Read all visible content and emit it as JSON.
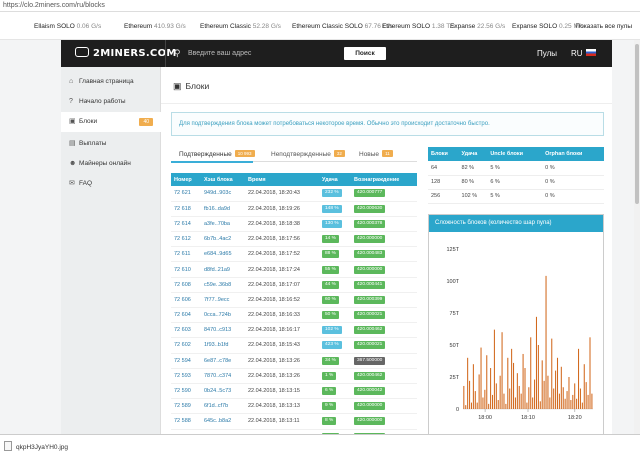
{
  "browser": {
    "url": "https://clo.2miners.com/ru/blocks"
  },
  "ticker": {
    "items": [
      {
        "name": "Ellaism SOLO",
        "value": "0.06 G/s"
      },
      {
        "name": "Ethereum",
        "value": "410.93 G/s"
      },
      {
        "name": "Ethereum Classic",
        "value": "52.28 G/s"
      },
      {
        "name": "Ethereum Classic SOLO",
        "value": "67.76 G/s"
      },
      {
        "name": "Ethereum SOLO",
        "value": "1.38 T/s"
      },
      {
        "name": "Expanse",
        "value": "22.56 G/s"
      },
      {
        "name": "Expanse SOLO",
        "value": "0.25 M/s"
      }
    ],
    "show_all": "Показать все пулы"
  },
  "navbar": {
    "logo": "2MINERS.COM",
    "search_placeholder": "Введите ваш адрес",
    "search_button": "Поиск",
    "pools": "Пулы",
    "lang": "RU"
  },
  "sidebar": {
    "items": [
      {
        "label": "Главная страница",
        "icon": "home-icon",
        "glyph": "⌂"
      },
      {
        "label": "Начало работы",
        "icon": "question-icon",
        "glyph": "?"
      },
      {
        "label": "Блоки",
        "icon": "cubes-icon",
        "glyph": "▣",
        "badge": "40"
      },
      {
        "label": "Выплаты",
        "icon": "money-icon",
        "glyph": "▤"
      },
      {
        "label": "Майнеры онлайн",
        "icon": "users-icon",
        "glyph": "☻"
      },
      {
        "label": "FAQ",
        "icon": "comments-icon",
        "glyph": "✉"
      }
    ]
  },
  "main": {
    "title": "Блоки",
    "notice": "Для подтверждения блока может потребоваться некоторое время. Обычно это происходит достаточно быстро.",
    "tabs": [
      {
        "label": "Подтвержденные",
        "count": "10 993"
      },
      {
        "label": "Неподтвержденные",
        "count": "32"
      },
      {
        "label": "Новые",
        "count": "11"
      }
    ]
  },
  "blocks": {
    "headers": [
      "Номер",
      "Хэш блока",
      "Время",
      "Удача",
      "Вознаграждение"
    ],
    "rows": [
      [
        "72 621",
        "949d..903c",
        "22.04.2018, 18:20:43",
        "232 %",
        "blue",
        "420.000777",
        "green"
      ],
      [
        "72 618",
        "fb16..da9d",
        "22.04.2018, 18:19:26",
        "148 %",
        "blue",
        "420.000630",
        "green"
      ],
      [
        "72 614",
        "a3fe..70ba",
        "22.04.2018, 18:18:38",
        "130 %",
        "blue",
        "420.000378",
        "green"
      ],
      [
        "72 612",
        "6b7b..4ac2",
        "22.04.2018, 18:17:56",
        "14 %",
        "green",
        "420.000000",
        "green"
      ],
      [
        "72 611",
        "e684..9d65",
        "22.04.2018, 18:17:52",
        "88 %",
        "green",
        "420.000483",
        "green"
      ],
      [
        "72 610",
        "d8fd..21a9",
        "22.04.2018, 18:17:24",
        "55 %",
        "green",
        "420.000000",
        "green"
      ],
      [
        "72 608",
        "c59e..36b8",
        "22.04.2018, 18:17:07",
        "44 %",
        "green",
        "420.000441",
        "green"
      ],
      [
        "72 606",
        "7f77..9ecc",
        "22.04.2018, 18:16:52",
        "60 %",
        "green",
        "420.000399",
        "green"
      ],
      [
        "72 604",
        "0cca..724b",
        "22.04.2018, 18:16:33",
        "50 %",
        "green",
        "420.000021",
        "green"
      ],
      [
        "72 603",
        "8470..c913",
        "22.04.2018, 18:16:17",
        "102 %",
        "blue",
        "420.000462",
        "green"
      ],
      [
        "72 602",
        "1f93..b1fd",
        "22.04.2018, 18:15:43",
        "423 %",
        "blue",
        "420.000021",
        "green"
      ],
      [
        "72 594",
        "6e87..c78e",
        "22.04.2018, 18:13:26",
        "34 %",
        "green",
        "367.500000",
        "grey"
      ],
      [
        "72 593",
        "7870..c374",
        "22.04.2018, 18:13:26",
        "1 %",
        "green",
        "420.000462",
        "green"
      ],
      [
        "72 590",
        "0b24..5c73",
        "22.04.2018, 18:13:15",
        "6 %",
        "green",
        "420.000042",
        "green"
      ],
      [
        "72 589",
        "6f1d..cf7b",
        "22.04.2018, 18:13:13",
        "9 %",
        "green",
        "420.000000",
        "green"
      ],
      [
        "72 588",
        "645c..b8a2",
        "22.04.2018, 18:13:11",
        "8 %",
        "green",
        "420.000000",
        "green"
      ],
      [
        "72 587",
        "c5e9..226b",
        "22.04.2018, 18:13:08",
        "34 %",
        "green",
        "420.000294",
        "green"
      ]
    ]
  },
  "luck": {
    "headers": [
      "Блоки",
      "Удача",
      "Uncle блоки",
      "Orphan блоки"
    ],
    "rows": [
      [
        "64",
        "82 %",
        "5 %",
        "0 %"
      ],
      [
        "128",
        "80 %",
        "6 %",
        "0 %"
      ],
      [
        "256",
        "102 %",
        "5 %",
        "0 %"
      ]
    ]
  },
  "chart": {
    "title": "Сложность блоков (количество шар пула)"
  },
  "chart_data": {
    "type": "bar",
    "title": "Сложность блоков (количество шар пула)",
    "color": "#d2691e",
    "ylim": [
      0,
      125
    ],
    "yticks": [
      "125T",
      "100T",
      "75T",
      "50T",
      "25T",
      "0"
    ],
    "xticks": [
      {
        "label": "18:00",
        "t": 0.17
      },
      {
        "label": "18:10",
        "t": 0.5
      },
      {
        "label": "18:20",
        "t": 0.86
      }
    ],
    "values": [
      18,
      3,
      40,
      22,
      5,
      35,
      14,
      5,
      27,
      48,
      9,
      15,
      42,
      4,
      32,
      11,
      62,
      20,
      7,
      26,
      60,
      12,
      4,
      40,
      16,
      47,
      36,
      9,
      28,
      18,
      12,
      43,
      32,
      5,
      17,
      56,
      9,
      23,
      72,
      50,
      6,
      38,
      22,
      104,
      26,
      9,
      55,
      16,
      30,
      40,
      12,
      33,
      17,
      8,
      14,
      25,
      7,
      11,
      20,
      8,
      47,
      16,
      5,
      35,
      21,
      11,
      56,
      12
    ]
  },
  "downloads": {
    "file": "qkpH3JyaYH0.jpg"
  }
}
